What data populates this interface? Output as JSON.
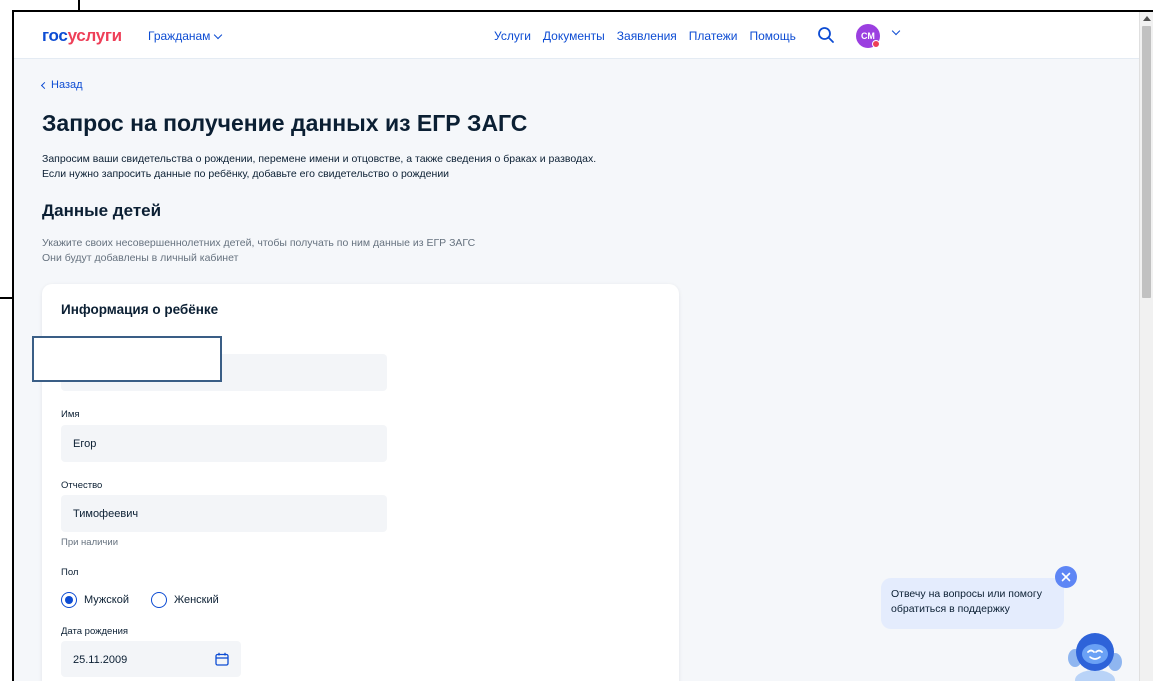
{
  "header": {
    "logo_part1": "гос",
    "logo_part2": "услуги",
    "citizens_menu": "Гражданам",
    "nav": [
      "Услуги",
      "Документы",
      "Заявления",
      "Платежи",
      "Помощь"
    ],
    "avatar_initials": "СМ"
  },
  "page": {
    "back_label": "Назад",
    "title": "Запрос на получение данных из ЕГР ЗАГС",
    "intro_line1": "Запросим ваши свидетельства о рождении, перемене имени и отцовстве, а также сведения о браках и разводах.",
    "intro_line2": "Если нужно запросить данные по ребёнку, добавьте его свидетельство о рождении",
    "section_title": "Данные детей",
    "hint_line1": "Укажите своих несовершеннолетних детей, чтобы получать по ним данные из ЕГР ЗАГС",
    "hint_line2": "Они будут добавлены в личный кабинет"
  },
  "form": {
    "card_title": "Информация о ребёнке",
    "surname_value": "",
    "name_label": "Имя",
    "name_value": "Егор",
    "patronymic_label": "Отчество",
    "patronymic_value": "Тимофеевич",
    "patronymic_hint": "При наличии",
    "gender_label": "Пол",
    "gender_options": [
      "Мужской",
      "Женский"
    ],
    "gender_selected": "Мужской",
    "birthdate_label": "Дата рождения",
    "birthdate_value": "25.11.2009"
  },
  "chat": {
    "bubble_line1": "Отвечу на вопросы или помогу",
    "bubble_line2": "обратиться в поддержку"
  },
  "colors": {
    "brand_blue": "#0d4cd3",
    "brand_red": "#ee3f58",
    "avatar": "#9b3fe0"
  }
}
